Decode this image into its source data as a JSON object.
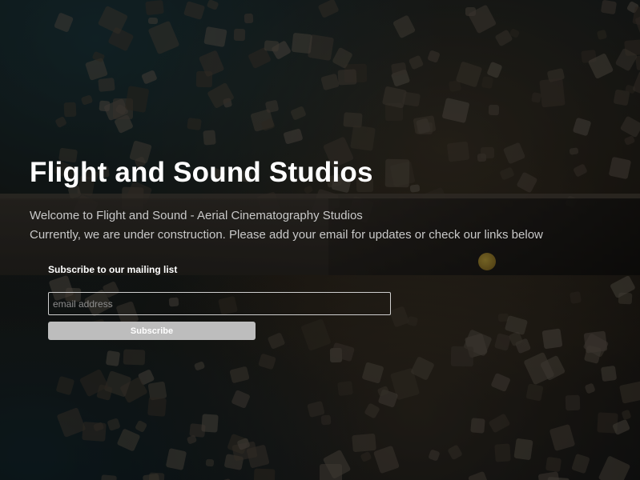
{
  "hero": {
    "title": "Flight and Sound Studios",
    "welcome_text": "Welcome to Flight and Sound - Aerial Cinematography Studios",
    "construction_text": "Currently, we are under construction. Please add your email for updates or check our links below"
  },
  "mailing_list": {
    "heading": "Subscribe to our mailing list",
    "email_placeholder": "email address",
    "email_value": "",
    "subscribe_label": "Subscribe"
  },
  "colors": {
    "title_text": "#ffffff",
    "body_text": "#c9c9c9",
    "button_background": "#bdbdbd",
    "input_border": "#cfcfcf"
  }
}
